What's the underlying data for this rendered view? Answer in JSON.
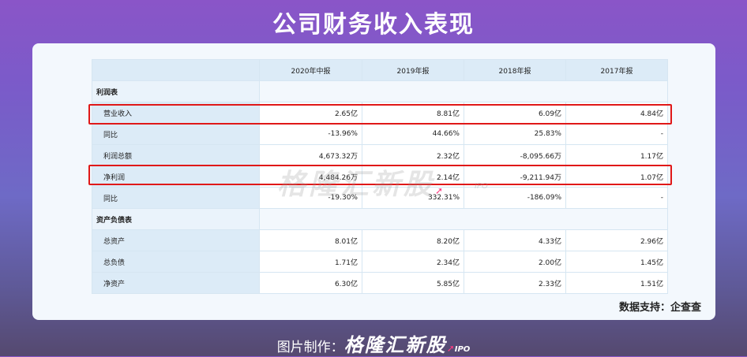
{
  "title": "公司财务收入表现",
  "table": {
    "columns": [
      "",
      "2020年中报",
      "2019年报",
      "2018年报",
      "2017年报"
    ],
    "sections": [
      {
        "name": "利润表",
        "rows": [
          {
            "label": "营业收入",
            "values": [
              "2.65亿",
              "8.81亿",
              "6.09亿",
              "4.84亿"
            ],
            "highlighted": true
          },
          {
            "label": "同比",
            "values": [
              "-13.96%",
              "44.66%",
              "25.83%",
              "-"
            ]
          },
          {
            "label": "利润总额",
            "values": [
              "4,673.32万",
              "2.32亿",
              "-8,095.66万",
              "1.17亿"
            ]
          },
          {
            "label": "净利润",
            "values": [
              "4,484.26万",
              "2.14亿",
              "-9,211.94万",
              "1.07亿"
            ],
            "highlighted": true
          },
          {
            "label": "同比",
            "values": [
              "-19.30%",
              "332.31%",
              "-186.09%",
              "-"
            ]
          }
        ]
      },
      {
        "name": "资产负债表",
        "rows": [
          {
            "label": "总资产",
            "values": [
              "8.01亿",
              "8.20亿",
              "4.33亿",
              "2.96亿"
            ]
          },
          {
            "label": "总负债",
            "values": [
              "1.71亿",
              "2.34亿",
              "2.00亿",
              "1.45亿"
            ]
          },
          {
            "label": "净资产",
            "values": [
              "6.30亿",
              "5.85亿",
              "2.33亿",
              "1.51亿"
            ]
          }
        ]
      }
    ],
    "highlight_color": "#e01818"
  },
  "watermark": {
    "brand": "格隆汇新股",
    "sub": "IPO"
  },
  "data_source": "数据支持：企查查",
  "footer": {
    "prefix": "图片制作：",
    "brand": "格隆汇新股",
    "ipo": "IPO"
  }
}
